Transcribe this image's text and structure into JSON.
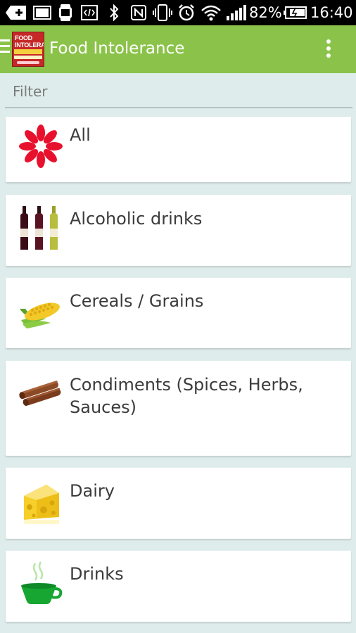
{
  "status_bar": {
    "battery_percent": "82%",
    "time": "16:40",
    "icons": [
      "add-icon",
      "image-icon",
      "watch-icon",
      "code-icon",
      "bluetooth-icon",
      "nfc-icon",
      "vibrate-icon",
      "alarm-icon",
      "wifi-icon",
      "signal-icon",
      "battery-icon"
    ]
  },
  "app_bar": {
    "title": "Food Intolerance",
    "logo_text": "FOOD INTOLERANCE"
  },
  "filter": {
    "placeholder": "Filter",
    "value": ""
  },
  "categories": [
    {
      "label": "All",
      "icon": "asterisk-icon"
    },
    {
      "label": "Alcoholic drinks",
      "icon": "wine-bottles-icon"
    },
    {
      "label": "Cereals / Grains",
      "icon": "corn-icon"
    },
    {
      "label": "Condiments (Spices, Herbs, Sauces)",
      "icon": "cinnamon-icon"
    },
    {
      "label": "Dairy",
      "icon": "cheese-icon"
    },
    {
      "label": "Drinks",
      "icon": "cup-icon"
    }
  ],
  "colors": {
    "app_bar": "#8bc34a",
    "background": "#dfecec",
    "status_bar": "#000000"
  }
}
